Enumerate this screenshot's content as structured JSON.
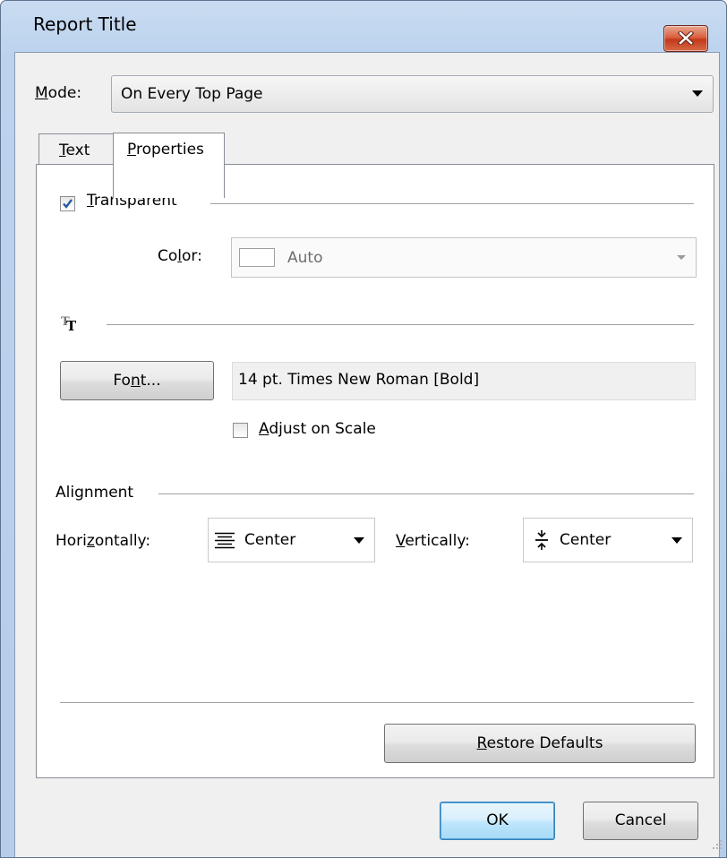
{
  "window": {
    "title": "Report Title"
  },
  "mode": {
    "label_u": "M",
    "label_rest": "ode:",
    "value": "On Every Top Page"
  },
  "tabs": [
    {
      "label_u": "T",
      "label_rest": "ext",
      "active": false
    },
    {
      "label_u": "P",
      "label_rest": "roperties",
      "active": true
    }
  ],
  "properties": {
    "transparent": {
      "label_u": "T",
      "label_rest": "ransparent",
      "checked": true
    },
    "color": {
      "label_pre": "Co",
      "label_u": "l",
      "label_rest": "or:",
      "value": "Auto",
      "swatch_color": "#ffffff"
    },
    "font_section_icon": "font-tt-icon",
    "font_button": {
      "label_pre": "Fo",
      "label_u": "n",
      "label_rest": "t..."
    },
    "font_description": "14 pt. Times New Roman  [Bold]",
    "adjust_on_scale": {
      "label_u": "A",
      "label_rest": "djust on Scale",
      "checked": false
    },
    "alignment": {
      "heading": "Alignment",
      "horizontal_label_pre": "Hori",
      "horizontal_label_u": "z",
      "horizontal_label_rest": "ontally:",
      "horizontal_value": "Center",
      "horizontal_icon": "align-center-icon",
      "vertical_label_u": "V",
      "vertical_label_rest": "ertically:",
      "vertical_value": "Center",
      "vertical_icon": "vertical-center-icon"
    },
    "restore_button": {
      "label_u": "R",
      "label_rest": "estore Defaults"
    }
  },
  "footer": {
    "ok_label": "OK",
    "cancel_label": "Cancel"
  },
  "colors": {
    "titlebar": "#bcd3ee",
    "dialog_bg": "#f0f0f0",
    "close_button": "#c2391b",
    "default_button_border": "#3c7fb1"
  }
}
